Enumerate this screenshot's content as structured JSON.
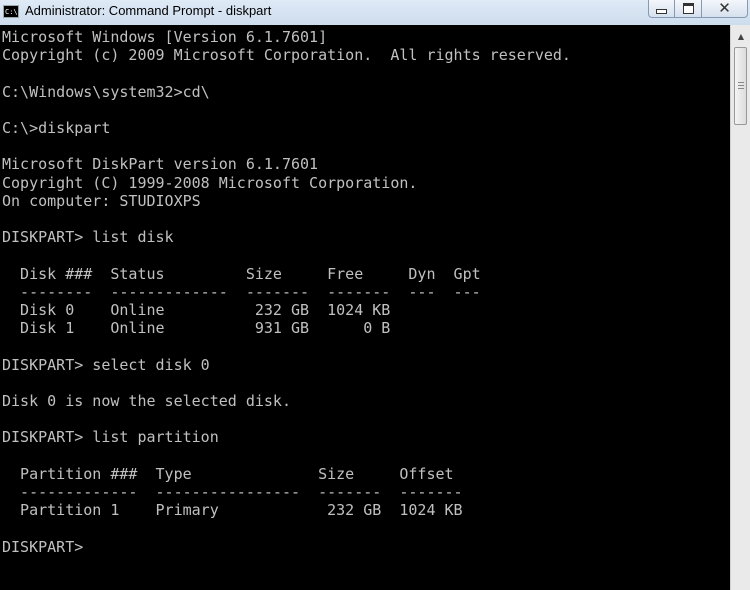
{
  "window": {
    "title": "Administrator: Command Prompt - diskpart",
    "icon": "cmd-icon",
    "controls": {
      "minimize": "minimize-icon",
      "maximize": "maximize-icon",
      "close": "close-icon",
      "close_glyph": "✕"
    }
  },
  "console": {
    "lines": [
      "Microsoft Windows [Version 6.1.7601]",
      "Copyright (c) 2009 Microsoft Corporation.  All rights reserved.",
      "",
      "C:\\Windows\\system32>cd\\",
      "",
      "C:\\>diskpart",
      "",
      "Microsoft DiskPart version 6.1.7601",
      "Copyright (C) 1999-2008 Microsoft Corporation.",
      "On computer: STUDIOXPS",
      "",
      "DISKPART> list disk",
      "",
      "  Disk ###  Status         Size     Free     Dyn  Gpt",
      "  --------  -------------  -------  -------  ---  ---",
      "  Disk 0    Online          232 GB  1024 KB",
      "  Disk 1    Online          931 GB      0 B",
      "",
      "DISKPART> select disk 0",
      "",
      "Disk 0 is now the selected disk.",
      "",
      "DISKPART> list partition",
      "",
      "  Partition ###  Type              Size     Offset",
      "  -------------  ----------------  -------  -------",
      "  Partition 1    Primary            232 GB  1024 KB",
      "",
      "DISKPART> "
    ],
    "disks": [
      {
        "disk": "Disk 0",
        "status": "Online",
        "size": "232 GB",
        "free": "1024 KB",
        "dyn": "",
        "gpt": ""
      },
      {
        "disk": "Disk 1",
        "status": "Online",
        "size": "931 GB",
        "free": "0 B",
        "dyn": "",
        "gpt": ""
      }
    ],
    "partitions": [
      {
        "partition": "Partition 1",
        "type": "Primary",
        "size": "232 GB",
        "offset": "1024 KB"
      }
    ],
    "prompt": "DISKPART> "
  },
  "scrollbar": {
    "up_arrow": "▲"
  }
}
